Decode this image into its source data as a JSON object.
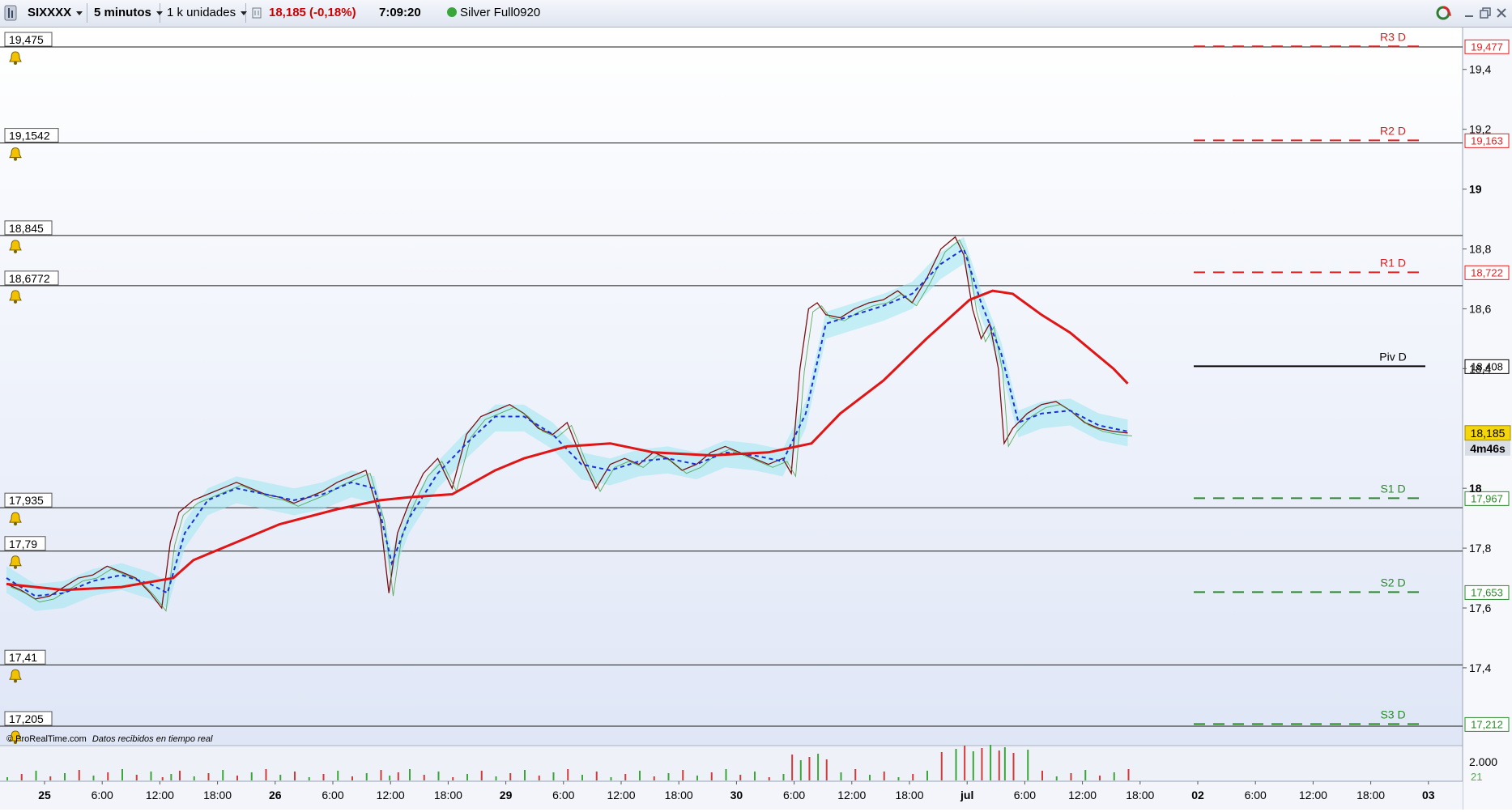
{
  "toolbar": {
    "symbol": "SIXXXX",
    "interval": "5 minutos",
    "units": "1 k unidades",
    "price_change": "18,185 (-0,18%)",
    "time": "7:09:20",
    "feed": "Silver Full0920",
    "colors": {
      "down": "#cc0000",
      "feed_dot": "#3aa63a"
    },
    "icons": [
      "app-menu-icon",
      "chart-settings-icon",
      "sync-icon",
      "minimize-icon",
      "maximize-icon",
      "close-icon"
    ]
  },
  "footer": {
    "copyright": "© ProRealTime.com",
    "note": "Datos recibidos en tiempo real"
  },
  "chart_data": {
    "type": "line",
    "title": "",
    "y_axis": {
      "range": [
        17.14,
        19.54
      ],
      "ticks": [
        "19,4",
        "19,2",
        "19",
        "18,8",
        "18,6",
        "18,4",
        "18",
        "17,8",
        "17,6",
        "17,4"
      ],
      "grid": false
    },
    "x_axis": {
      "ticks": [
        "25",
        "6:00",
        "12:00",
        "18:00",
        "26",
        "6:00",
        "12:00",
        "18:00",
        "29",
        "6:00",
        "12:00",
        "18:00",
        "30",
        "6:00",
        "12:00",
        "18:00",
        "jul",
        "6:00",
        "12:00",
        "18:00",
        "02",
        "6:00",
        "12:00",
        "18:00",
        "03"
      ],
      "bold_ticks": [
        "25",
        "26",
        "29",
        "30",
        "jul",
        "02",
        "03"
      ]
    },
    "horizontal_levels": [
      {
        "label": "19,475",
        "value": 19.475
      },
      {
        "label": "19,1542",
        "value": 19.1542
      },
      {
        "label": "18,845",
        "value": 18.845
      },
      {
        "label": "18,6772",
        "value": 18.6772
      },
      {
        "label": "17,935",
        "value": 17.935
      },
      {
        "label": "17,79",
        "value": 17.79
      },
      {
        "label": "17,41",
        "value": 17.41
      },
      {
        "label": "17,205",
        "value": 17.205
      }
    ],
    "pivot_levels": [
      {
        "name": "R3 D",
        "value": 19.477,
        "label": "19,477",
        "color": "#e02020"
      },
      {
        "name": "R2 D",
        "value": 19.163,
        "label": "19,163",
        "color": "#e02020"
      },
      {
        "name": "R1 D",
        "value": 18.722,
        "label": "18,722",
        "color": "#e02020"
      },
      {
        "name": "Piv D",
        "value": 18.408,
        "label": "18,408",
        "color": "#000000"
      },
      {
        "name": "S1 D",
        "value": 17.967,
        "label": "17,967",
        "color": "#2a8a2a"
      },
      {
        "name": "S2 D",
        "value": 17.653,
        "label": "17,653",
        "color": "#2a8a2a"
      },
      {
        "name": "S3 D",
        "value": 17.212,
        "label": "17,212",
        "color": "#2a8a2a"
      }
    ],
    "current_price": {
      "label": "18,185",
      "value": 18.185,
      "countdown": "4m46s"
    },
    "price_points": [
      [
        0.0,
        17.68
      ],
      [
        0.5,
        17.66
      ],
      [
        1.0,
        17.63
      ],
      [
        1.5,
        17.64
      ],
      [
        2.0,
        17.67
      ],
      [
        2.5,
        17.7
      ],
      [
        3.0,
        17.71
      ],
      [
        3.5,
        17.74
      ],
      [
        4.0,
        17.72
      ],
      [
        4.5,
        17.7
      ],
      [
        5.0,
        17.65
      ],
      [
        5.4,
        17.6
      ],
      [
        5.7,
        17.82
      ],
      [
        6.0,
        17.92
      ],
      [
        6.5,
        17.96
      ],
      [
        7.0,
        17.98
      ],
      [
        7.5,
        18.0
      ],
      [
        8.0,
        18.02
      ],
      [
        8.5,
        18.0
      ],
      [
        9.0,
        17.98
      ],
      [
        9.5,
        17.97
      ],
      [
        10.0,
        17.95
      ],
      [
        10.5,
        17.97
      ],
      [
        11.0,
        17.99
      ],
      [
        11.5,
        18.02
      ],
      [
        12.0,
        18.04
      ],
      [
        12.5,
        18.06
      ],
      [
        13.0,
        17.9
      ],
      [
        13.3,
        17.65
      ],
      [
        13.6,
        17.85
      ],
      [
        14.0,
        17.95
      ],
      [
        14.5,
        18.05
      ],
      [
        15.0,
        18.1
      ],
      [
        15.5,
        18.0
      ],
      [
        16.0,
        18.18
      ],
      [
        16.5,
        18.24
      ],
      [
        17.0,
        18.26
      ],
      [
        17.5,
        18.28
      ],
      [
        18.0,
        18.25
      ],
      [
        18.5,
        18.2
      ],
      [
        19.0,
        18.18
      ],
      [
        19.5,
        18.22
      ],
      [
        20.0,
        18.1
      ],
      [
        20.5,
        18.0
      ],
      [
        21.0,
        18.08
      ],
      [
        21.5,
        18.1
      ],
      [
        22.0,
        18.08
      ],
      [
        22.5,
        18.12
      ],
      [
        23.0,
        18.1
      ],
      [
        23.5,
        18.06
      ],
      [
        24.0,
        18.08
      ],
      [
        24.5,
        18.12
      ],
      [
        25.0,
        18.14
      ],
      [
        25.5,
        18.12
      ],
      [
        26.0,
        18.1
      ],
      [
        26.5,
        18.08
      ],
      [
        27.0,
        18.1
      ],
      [
        27.3,
        18.05
      ],
      [
        27.6,
        18.4
      ],
      [
        27.9,
        18.6
      ],
      [
        28.2,
        18.62
      ],
      [
        28.5,
        18.58
      ],
      [
        29.0,
        18.57
      ],
      [
        29.5,
        18.6
      ],
      [
        30.0,
        18.62
      ],
      [
        30.5,
        18.63
      ],
      [
        31.0,
        18.66
      ],
      [
        31.5,
        18.62
      ],
      [
        32.0,
        18.7
      ],
      [
        32.5,
        18.8
      ],
      [
        33.0,
        18.84
      ],
      [
        33.3,
        18.78
      ],
      [
        33.6,
        18.6
      ],
      [
        33.9,
        18.5
      ],
      [
        34.2,
        18.55
      ],
      [
        34.5,
        18.4
      ],
      [
        34.7,
        18.15
      ],
      [
        35.0,
        18.2
      ],
      [
        35.5,
        18.25
      ],
      [
        36.0,
        18.28
      ],
      [
        36.5,
        18.29
      ],
      [
        37.0,
        18.26
      ],
      [
        37.5,
        18.22
      ],
      [
        38.0,
        18.2
      ],
      [
        38.5,
        18.19
      ],
      [
        39.0,
        18.185
      ]
    ],
    "ma_points": [
      [
        0.0,
        17.68
      ],
      [
        2.0,
        17.66
      ],
      [
        4.0,
        17.67
      ],
      [
        5.8,
        17.7
      ],
      [
        6.5,
        17.76
      ],
      [
        8.0,
        17.82
      ],
      [
        9.5,
        17.88
      ],
      [
        11.5,
        17.93
      ],
      [
        13.0,
        17.96
      ],
      [
        14.0,
        17.97
      ],
      [
        15.5,
        17.98
      ],
      [
        17.0,
        18.06
      ],
      [
        18.0,
        18.1
      ],
      [
        19.5,
        18.14
      ],
      [
        21.0,
        18.15
      ],
      [
        22.5,
        18.12
      ],
      [
        24.5,
        18.11
      ],
      [
        26.5,
        18.12
      ],
      [
        28.0,
        18.15
      ],
      [
        29.0,
        18.25
      ],
      [
        30.5,
        18.36
      ],
      [
        32.0,
        18.5
      ],
      [
        33.5,
        18.63
      ],
      [
        34.3,
        18.66
      ],
      [
        35.0,
        18.65
      ],
      [
        36.0,
        18.58
      ],
      [
        37.0,
        18.52
      ],
      [
        37.5,
        18.48
      ],
      [
        38.5,
        18.4
      ],
      [
        39.0,
        18.35
      ]
    ],
    "signal_points": [
      [
        0.0,
        17.7
      ],
      [
        1.0,
        17.64
      ],
      [
        2.0,
        17.65
      ],
      [
        3.0,
        17.69
      ],
      [
        4.0,
        17.71
      ],
      [
        5.0,
        17.68
      ],
      [
        5.6,
        17.65
      ],
      [
        6.2,
        17.85
      ],
      [
        7.0,
        17.96
      ],
      [
        8.0,
        18.0
      ],
      [
        9.0,
        17.98
      ],
      [
        10.0,
        17.96
      ],
      [
        11.0,
        17.98
      ],
      [
        12.0,
        18.02
      ],
      [
        12.8,
        18.0
      ],
      [
        13.4,
        17.75
      ],
      [
        14.0,
        17.9
      ],
      [
        15.0,
        18.05
      ],
      [
        16.0,
        18.15
      ],
      [
        17.0,
        18.24
      ],
      [
        18.0,
        18.24
      ],
      [
        19.0,
        18.18
      ],
      [
        20.0,
        18.08
      ],
      [
        21.0,
        18.06
      ],
      [
        22.0,
        18.09
      ],
      [
        23.0,
        18.1
      ],
      [
        24.0,
        18.08
      ],
      [
        25.0,
        18.12
      ],
      [
        26.0,
        18.11
      ],
      [
        27.0,
        18.09
      ],
      [
        27.8,
        18.25
      ],
      [
        28.5,
        18.55
      ],
      [
        29.5,
        18.58
      ],
      [
        30.5,
        18.61
      ],
      [
        31.5,
        18.65
      ],
      [
        32.5,
        18.75
      ],
      [
        33.3,
        18.8
      ],
      [
        33.9,
        18.62
      ],
      [
        34.6,
        18.45
      ],
      [
        35.2,
        18.22
      ],
      [
        36.0,
        18.25
      ],
      [
        37.0,
        18.26
      ],
      [
        38.0,
        18.21
      ],
      [
        39.0,
        18.19
      ]
    ],
    "volume_axis": {
      "labels": [
        "2.000",
        "21"
      ]
    }
  }
}
